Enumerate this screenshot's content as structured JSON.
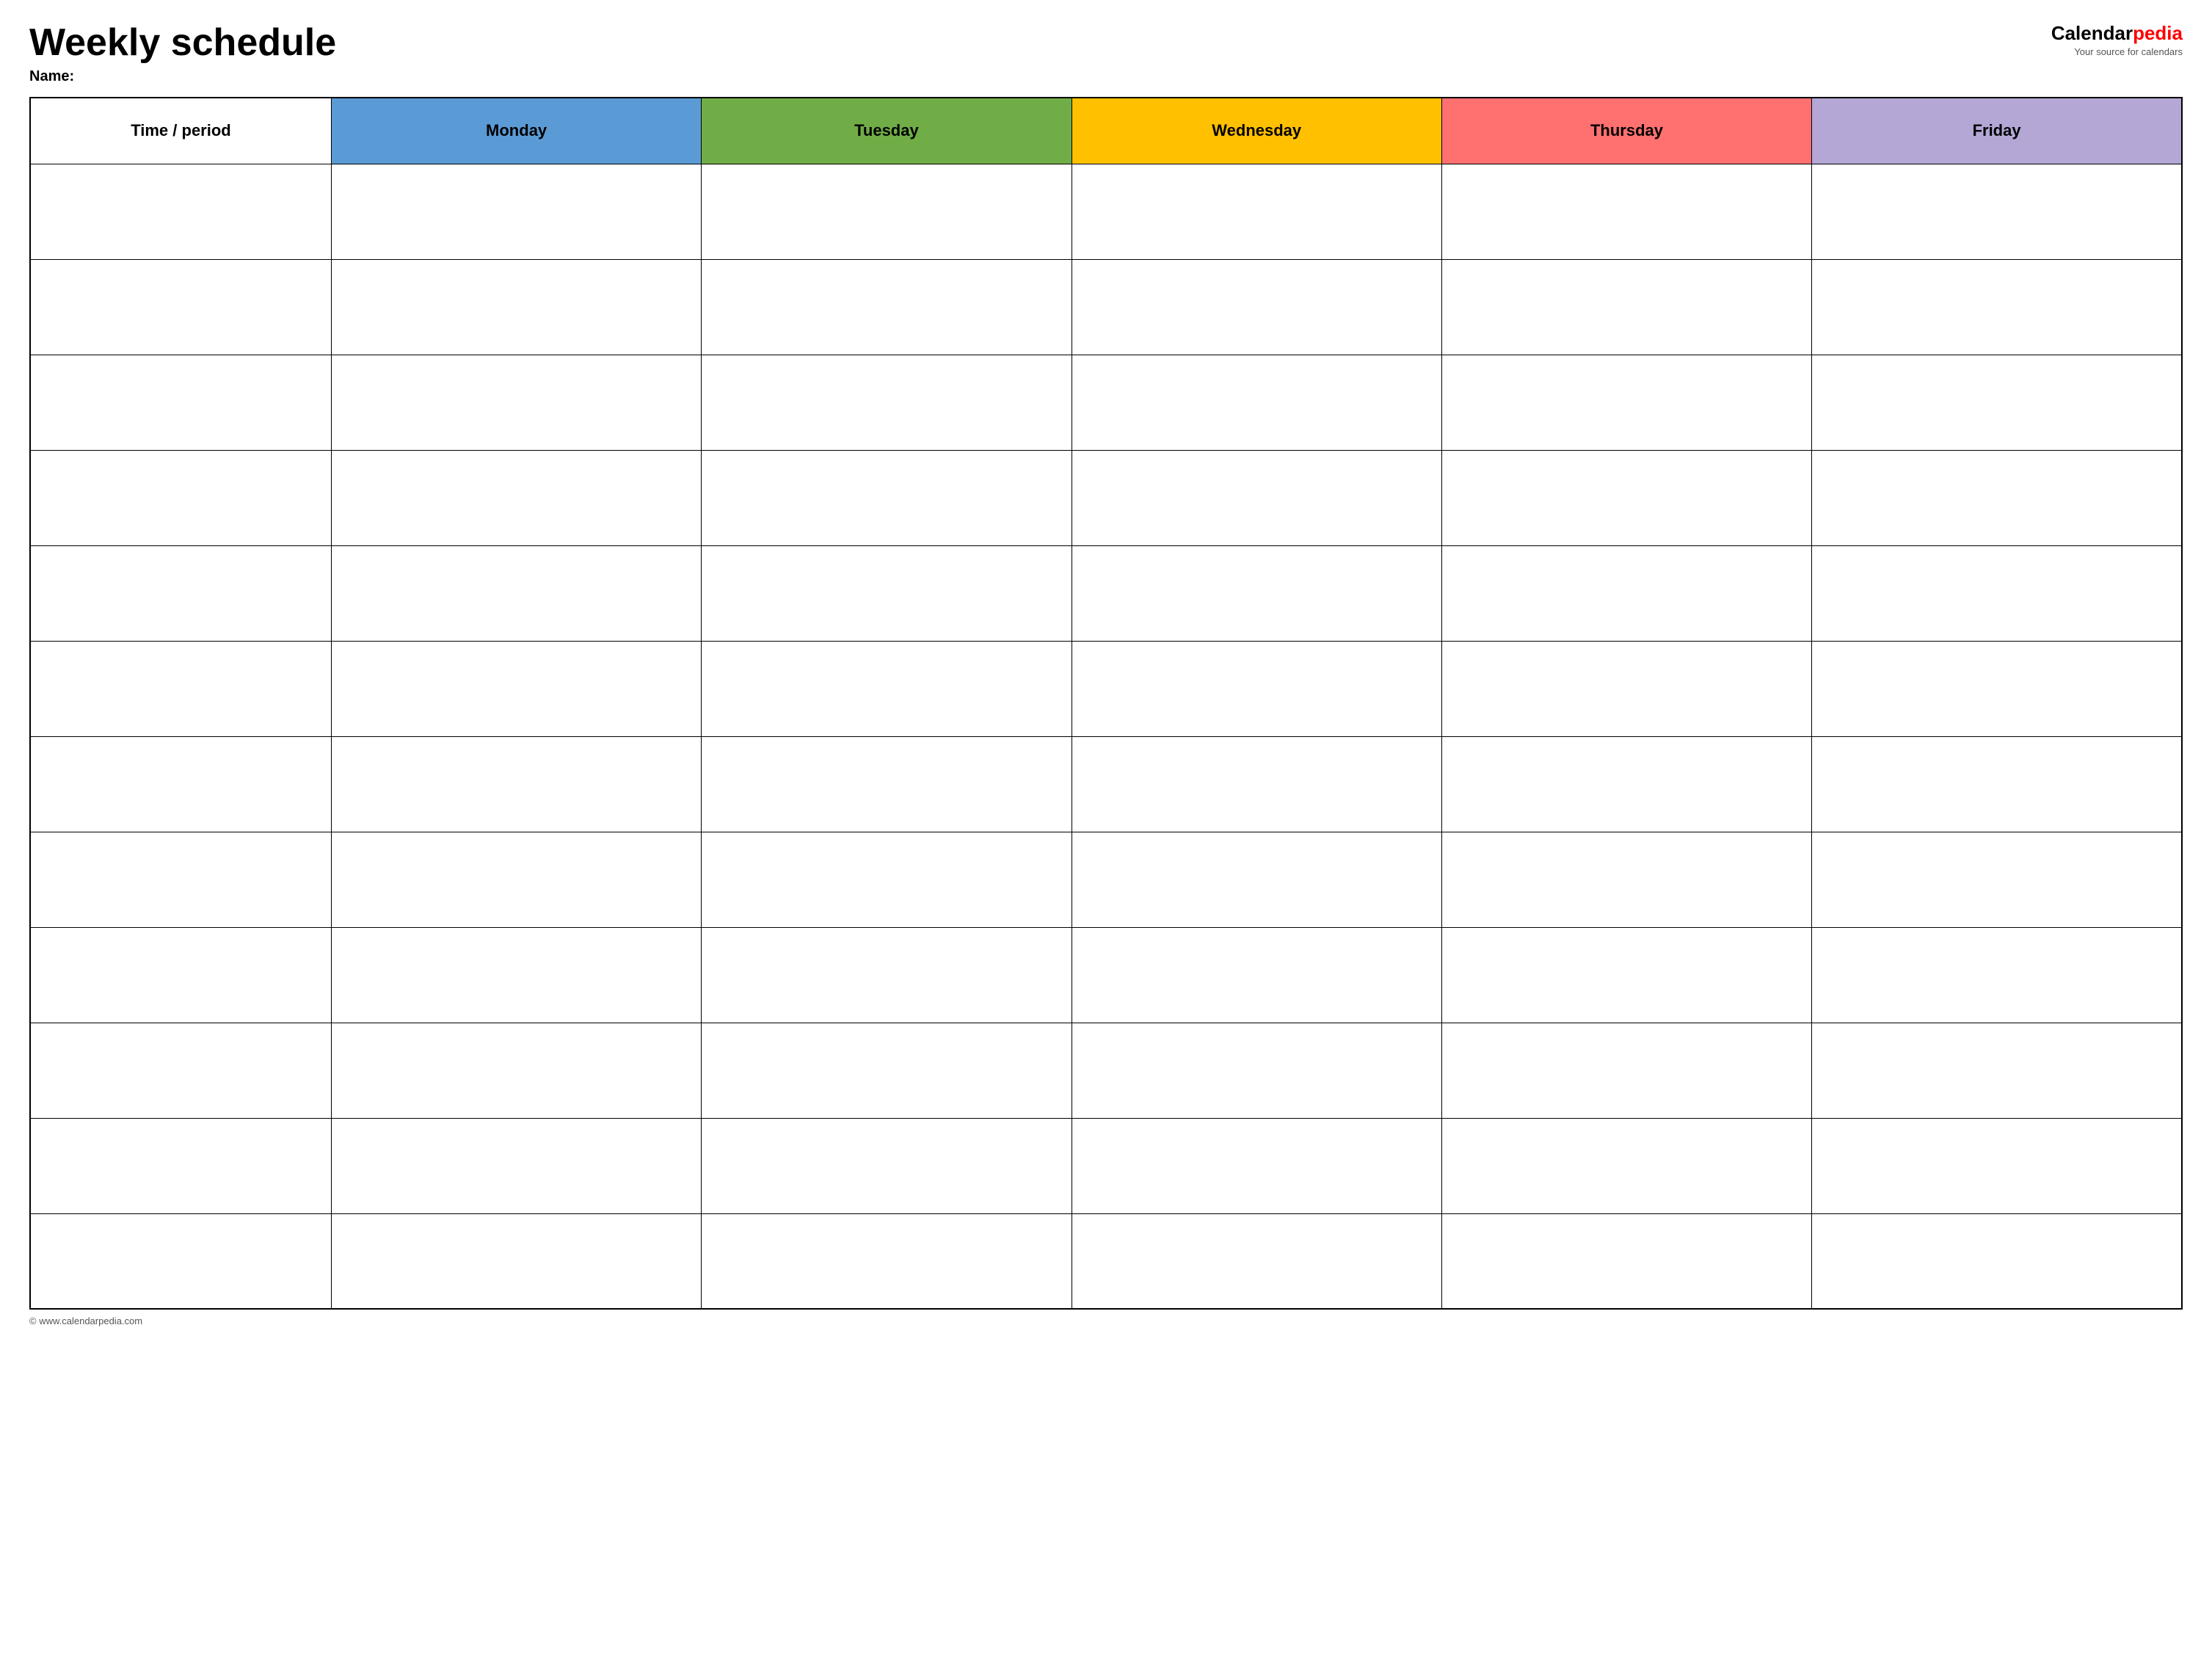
{
  "header": {
    "title": "Weekly schedule",
    "name_label": "Name:",
    "logo_calendar": "Calendar",
    "logo_pedia": "pedia",
    "logo_tagline": "Your source for calendars"
  },
  "table": {
    "columns": [
      {
        "id": "time",
        "label": "Time / period",
        "color": "white"
      },
      {
        "id": "monday",
        "label": "Monday",
        "color": "#5b9bd5"
      },
      {
        "id": "tuesday",
        "label": "Tuesday",
        "color": "#70ad47"
      },
      {
        "id": "wednesday",
        "label": "Wednesday",
        "color": "#ffc000"
      },
      {
        "id": "thursday",
        "label": "Thursday",
        "color": "#ff7070"
      },
      {
        "id": "friday",
        "label": "Friday",
        "color": "#b4a7d6"
      }
    ],
    "row_count": 12
  },
  "footer": {
    "url": "© www.calendarpedia.com"
  }
}
